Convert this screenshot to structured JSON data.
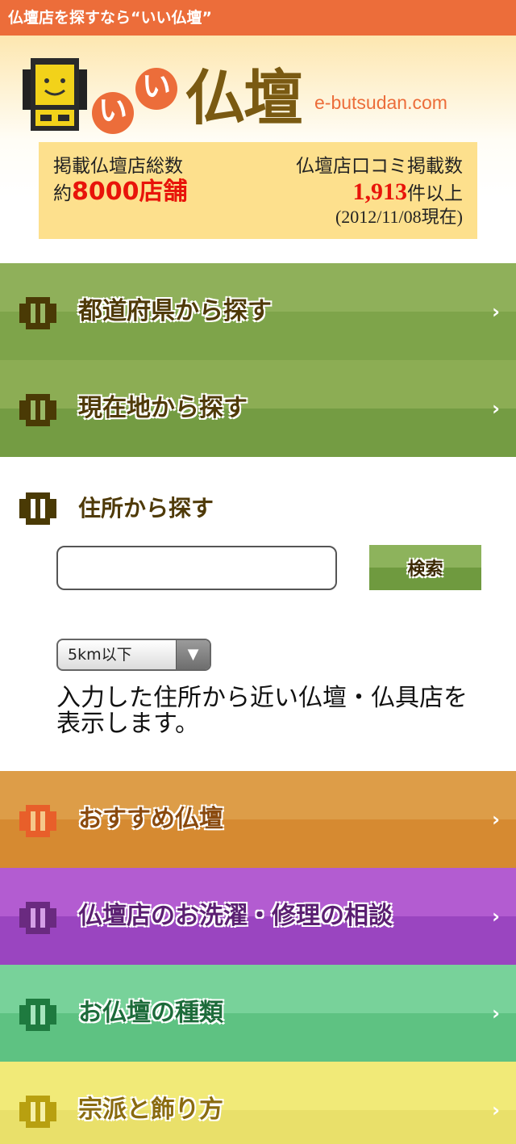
{
  "topbar": {
    "title": "仏壇店を探すなら“いい仏壇”"
  },
  "header": {
    "logo_i1": "い",
    "logo_i2": "い",
    "logo_main": "仏壇",
    "domain": "e-butsudan.com"
  },
  "stats": {
    "shops_label": "掲載仏壇店総数",
    "shops_prefix": "約",
    "shops_value": "8000店舗",
    "reviews_label": "仏壇店口コミ掲載数",
    "reviews_value": "1,913",
    "reviews_suffix": "件以上",
    "as_of": "(2012/11/08現在)"
  },
  "nav": {
    "prefecture": "都道府県から探す",
    "current_location": "現在地から探す",
    "recommended": "おすすめ仏壇",
    "cleaning": "仏壇店のお洗濯・修理の相談",
    "types": "お仏壇の種類",
    "sects": "宗派と飾り方",
    "chevron": "›"
  },
  "address_search": {
    "title": "住所から探す",
    "input_value": "",
    "button_label": "検索",
    "distance_selected": "5km以下",
    "description": "入力した住所から近い仏壇・仏具店を表示します。"
  },
  "colors": {
    "topbar": "#ec6d3a",
    "accent_red": "#e8140a",
    "green": "#7ea44a",
    "orange": "#d68a31",
    "purple": "#9a45c0",
    "teal": "#5ec282",
    "yellow": "#e9e06a"
  },
  "icons": {
    "mascot": "butsudan-mascot-icon",
    "row": "butsudan-icon",
    "chevron": "chevron-right-icon",
    "dropdown": "triangle-down-icon"
  }
}
